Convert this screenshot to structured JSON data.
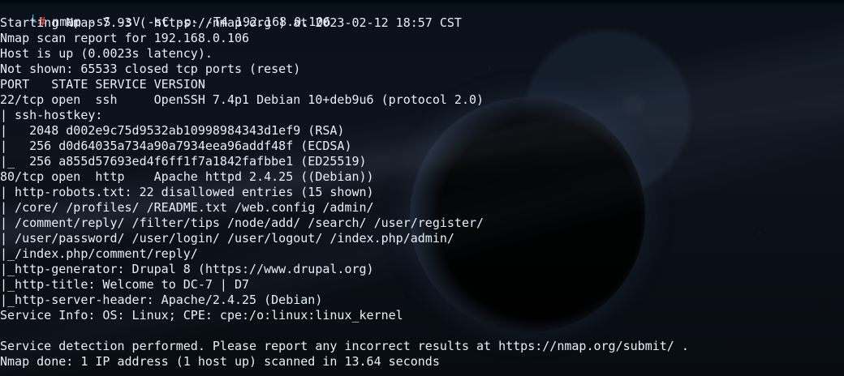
{
  "terminal": {
    "prompt_mark": "└",
    "prompt_hash": "#",
    "command": "nmap -sS -sV -sC -p- -T4 192.168.0.106",
    "lines": [
      "Starting Nmap 7.93 ( https://nmap.org ) at 2023-02-12 18:57 CST",
      "Nmap scan report for 192.168.0.106",
      "Host is up (0.0023s latency).",
      "Not shown: 65533 closed tcp ports (reset)",
      "PORT   STATE SERVICE VERSION",
      "22/tcp open  ssh     OpenSSH 7.4p1 Debian 10+deb9u6 (protocol 2.0)",
      "| ssh-hostkey:",
      "|   2048 d002e9c75d9532ab10998984343d1ef9 (RSA)",
      "|   256 d0d64035a734a90a7934eea96addf48f (ECDSA)",
      "|_  256 a855d57693ed4f6ff1f7a1842fafbbe1 (ED25519)",
      "80/tcp open  http    Apache httpd 2.4.25 ((Debian))",
      "| http-robots.txt: 22 disallowed entries (15 shown)",
      "| /core/ /profiles/ /README.txt /web.config /admin/",
      "| /comment/reply/ /filter/tips /node/add/ /search/ /user/register/",
      "| /user/password/ /user/login/ /user/logout/ /index.php/admin/",
      "|_/index.php/comment/reply/",
      "|_http-generator: Drupal 8 (https://www.drupal.org)",
      "|_http-title: Welcome to DC-7 | D7",
      "|_http-server-header: Apache/2.4.25 (Debian)",
      "Service Info: OS: Linux; CPE: cpe:/o:linux:linux_kernel",
      "",
      "Service detection performed. Please report any incorrect results at https://nmap.org/submit/ .",
      "Nmap done: 1 IP address (1 host up) scanned in 13.64 seconds"
    ]
  },
  "colors": {
    "text": "#e7edf6",
    "prompt_mark": "#49a2ff",
    "prompt_hash": "#ff4d4d",
    "background": "#0b0f16"
  }
}
